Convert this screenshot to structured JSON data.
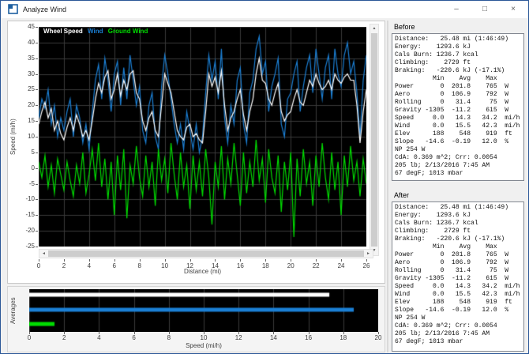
{
  "window": {
    "title": "Analyze Wind",
    "controls": {
      "minimize": "–",
      "maximize": "□",
      "close": "×"
    }
  },
  "scrollbar_icons": {
    "up": "▲",
    "down": "▼",
    "left": "◄",
    "right": "►"
  },
  "before": {
    "label": "Before",
    "text": "Distance:   25.48 mi (1:46:49)\nEnergy:    1293.6 kJ\nCals Burn: 1236.7 kcal\nClimbing:    2729 ft\nBraking:   -220.6 kJ (-17.1%)\n          Min    Avg    Max\nPower       0  201.8    765  W\nAero        0  106.9    792  W\nRolling     0   31.4     75  W\nGravity -1305  -11.2    615  W\nSpeed     0.0   14.3   34.2  mi/h\nWind      0.0   15.5   42.3  mi/h\nElev      188    548    919  ft\nSlope   -14.6  -0.19   12.0  %\nNP 254 W\nCdA: 0.369 m^2; Crr: 0.0054\n205 lb; 2/13/2016 7:45 AM\n67 degF; 1013 mbar"
  },
  "after": {
    "label": "After",
    "text": "Distance:   25.48 mi (1:46:49)\nEnergy:    1293.6 kJ\nCals Burn: 1236.7 kcal\nClimbing:    2729 ft\nBraking:   -220.6 kJ (-17.1%)\n          Min    Avg    Max\nPower       0  201.8    765  W\nAero        0  106.9    792  W\nRolling     0   31.4     75  W\nGravity -1305  -11.2    615  W\nSpeed     0.0   14.3   34.2  mi/h\nWind      0.0   15.5   42.3  mi/h\nElev      188    548    919  ft\nSlope   -14.6  -0.19   12.0  %\nNP 254 W\nCdA: 0.369 m^2; Crr: 0.0054\n205 lb; 2/13/2016 7:45 AM\n67 degF; 1013 mbar"
  },
  "colors": {
    "window_border": "#2b5797",
    "plot_background": "#000000",
    "grid": "#3a3a3a",
    "wheel_speed": "#ffffff",
    "wind": "#1b7fd4",
    "ground_wind": "#00dc00"
  },
  "chart_data": [
    {
      "type": "line",
      "title": "",
      "xlabel": "Distance (mi)",
      "ylabel": "Speed (mi/h)",
      "xlim": [
        0,
        26
      ],
      "ylim": [
        -25,
        45
      ],
      "xticks": [
        0,
        2,
        4,
        6,
        8,
        10,
        12,
        14,
        16,
        18,
        20,
        22,
        24,
        26
      ],
      "yticks": [
        45,
        40,
        35,
        30,
        25,
        20,
        15,
        10,
        5,
        0,
        -5,
        -10,
        -15,
        -20,
        -25
      ],
      "grid": true,
      "background": "#000000",
      "gridcolor": "#3a3a3a",
      "legend_position": "top-left",
      "x_start": 0,
      "x_step": 0.25,
      "series": [
        {
          "name": "Wheel Speed",
          "color": "#ffffff",
          "values": [
            14,
            18,
            21,
            16,
            19,
            12,
            15,
            11,
            9,
            13,
            16,
            12,
            17,
            14,
            10,
            12,
            9,
            15,
            22,
            27,
            24,
            29,
            31,
            22,
            25,
            30,
            23,
            28,
            25,
            30,
            31,
            24,
            22,
            15,
            12,
            16,
            18,
            12,
            10,
            20,
            30,
            27,
            24,
            18,
            12,
            10,
            9,
            13,
            14,
            10,
            11,
            9,
            8,
            18,
            30,
            26,
            29,
            24,
            31,
            20,
            12,
            16,
            18,
            22,
            25,
            17,
            12,
            18,
            22,
            30,
            35,
            28,
            27,
            22,
            20,
            24,
            27,
            18,
            15,
            17,
            18,
            22,
            25,
            21,
            20,
            24,
            28,
            26,
            30,
            27,
            25,
            26,
            28,
            25,
            30,
            28,
            27,
            29,
            30,
            28,
            28,
            20,
            8,
            18,
            25
          ]
        },
        {
          "name": "Wind",
          "color": "#1b7fd4",
          "values": [
            16,
            22,
            19,
            25,
            14,
            20,
            10,
            16,
            12,
            18,
            22,
            10,
            20,
            16,
            8,
            14,
            6,
            18,
            28,
            33,
            22,
            35,
            28,
            18,
            30,
            34,
            20,
            32,
            22,
            36,
            28,
            20,
            26,
            12,
            8,
            20,
            24,
            10,
            6,
            26,
            36,
            30,
            22,
            14,
            8,
            14,
            6,
            18,
            12,
            6,
            14,
            5,
            10,
            24,
            36,
            28,
            34,
            22,
            38,
            16,
            8,
            20,
            14,
            28,
            32,
            14,
            8,
            24,
            28,
            38,
            42,
            30,
            34,
            18,
            26,
            30,
            35,
            14,
            10,
            22,
            24,
            30,
            34,
            18,
            26,
            32,
            36,
            24,
            38,
            30,
            22,
            32,
            36,
            22,
            38,
            30,
            26,
            36,
            40,
            30,
            34,
            24,
            10,
            28,
            36
          ]
        },
        {
          "name": "Ground Wind",
          "color": "#00dc00",
          "values": [
            2,
            -3,
            4,
            -6,
            1,
            -8,
            3,
            -2,
            -7,
            2,
            -4,
            -9,
            1,
            -5,
            5,
            -8,
            -2,
            6,
            -4,
            8,
            -6,
            3,
            -10,
            2,
            -15,
            4,
            -7,
            6,
            -16,
            1,
            -5,
            7,
            -3,
            -9,
            4,
            -6,
            2,
            -12,
            6,
            -4,
            3,
            -8,
            8,
            -2,
            -10,
            5,
            -6,
            1,
            -13,
            4,
            -7,
            2,
            -9,
            6,
            -3,
            -18,
            2,
            -6,
            7,
            -10,
            3,
            -5,
            8,
            -2,
            -12,
            5,
            -8,
            2,
            -6,
            9,
            -4,
            3,
            -11,
            6,
            -3,
            -8,
            4,
            -14,
            2,
            -7,
            5,
            -22,
            3,
            -9,
            6,
            -5,
            2,
            -12,
            4,
            -6,
            8,
            -3,
            -10,
            5,
            -7,
            2,
            -15,
            4,
            -6,
            7,
            -4,
            2,
            -9,
            3,
            -5
          ]
        }
      ]
    },
    {
      "type": "bar",
      "orientation": "horizontal",
      "title": "",
      "xlabel": "Speed (mi/h)",
      "ylabel": "Averages",
      "xlim": [
        0,
        20
      ],
      "xticks": [
        0,
        2,
        4,
        6,
        8,
        10,
        12,
        14,
        16,
        18,
        20
      ],
      "grid": true,
      "background": "#000000",
      "gridcolor": "#3a3a3a",
      "categories": [
        "Wheel Speed",
        "Wind",
        "Ground Wind"
      ],
      "values": [
        17.2,
        18.6,
        1.45
      ],
      "colors": [
        "#ffffff",
        "#1b7fd4",
        "#00dc00"
      ]
    }
  ]
}
